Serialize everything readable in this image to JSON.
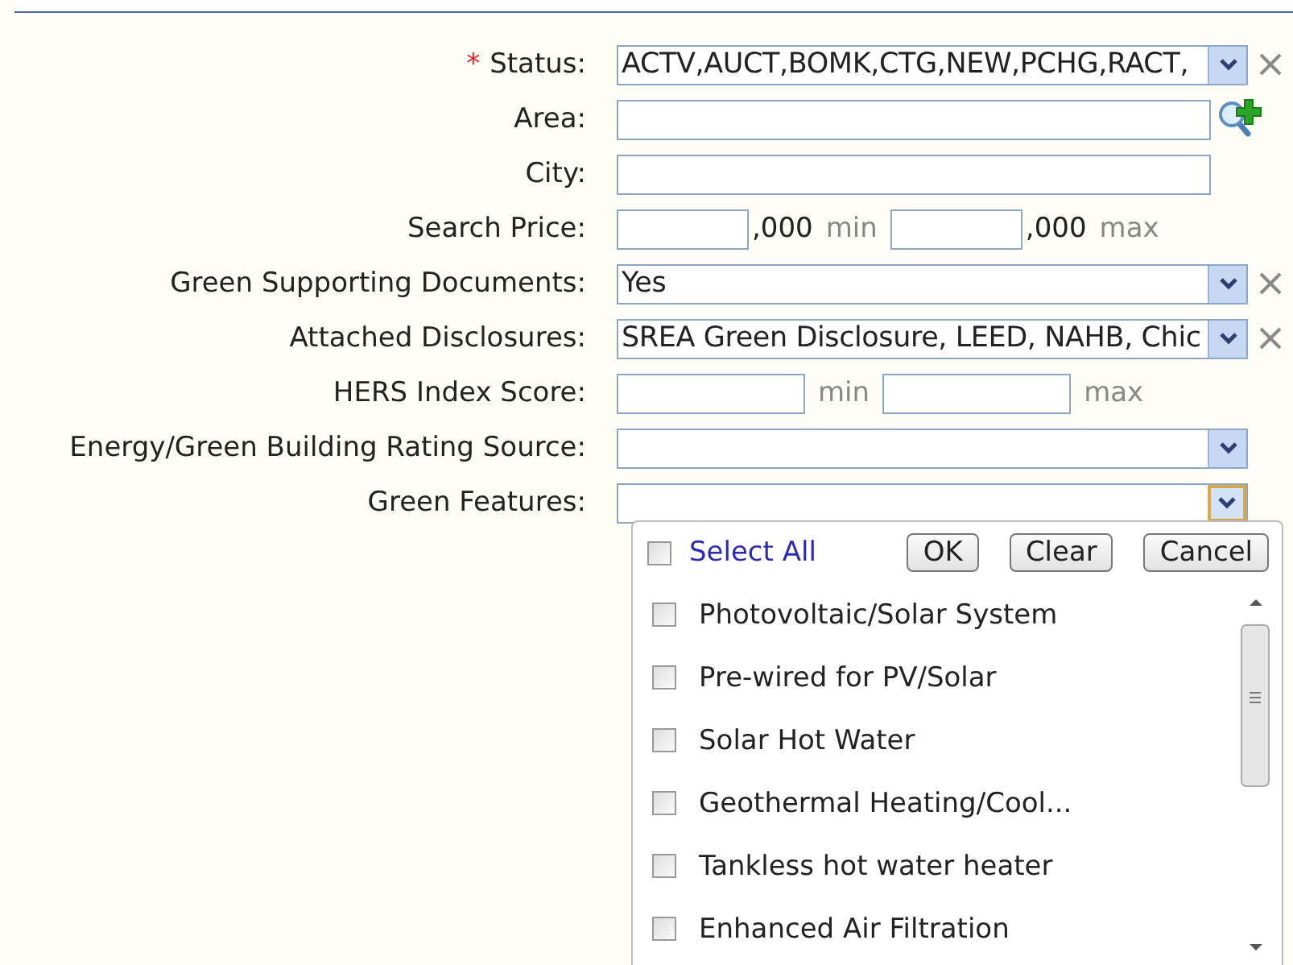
{
  "form": {
    "fields": [
      {
        "label": "Status:",
        "required_mark": "*",
        "kind": "select",
        "value": "ACTV,AUCT,BOMK,CTG,NEW,PCHG,RACT,",
        "clearable": true,
        "focused": false
      },
      {
        "label": "Area:",
        "kind": "text",
        "lookup": true
      },
      {
        "label": "City:",
        "kind": "text",
        "lookup": false
      },
      {
        "label": "Search Price:",
        "kind": "range",
        "min_suffix": ",000",
        "min_label": "min",
        "max_suffix": ",000",
        "max_label": "max",
        "wide": false
      },
      {
        "label": "Green Supporting Documents:",
        "kind": "select",
        "value": "Yes",
        "clearable": true,
        "focused": false
      },
      {
        "label": "Attached Disclosures:",
        "kind": "select",
        "value": "SREA Green Disclosure, LEED, NAHB, Chic",
        "clearable": true,
        "focused": false
      },
      {
        "label": "HERS Index Score:",
        "kind": "range",
        "min_label": "min",
        "max_label": "max",
        "wide": true
      },
      {
        "label": "Energy/Green Building Rating Source:",
        "kind": "select",
        "clearable": false,
        "focused": false
      },
      {
        "label": "Green Features:",
        "kind": "select",
        "clearable": false,
        "focused": true
      }
    ]
  },
  "dropdown": {
    "select_all": {
      "label": "Select All",
      "checked": false
    },
    "buttons": [
      "OK",
      "Clear",
      "Cancel"
    ],
    "options": [
      {
        "label": "Photovoltaic/Solar System",
        "checked": false
      },
      {
        "label": "Pre-wired for PV/Solar",
        "checked": false
      },
      {
        "label": "Solar Hot Water",
        "checked": false
      },
      {
        "label": "Geothermal Heating/Cool...",
        "checked": false
      },
      {
        "label": "Tankless hot water heater",
        "checked": false
      },
      {
        "label": "Enhanced Air Filtration",
        "checked": false
      }
    ]
  }
}
